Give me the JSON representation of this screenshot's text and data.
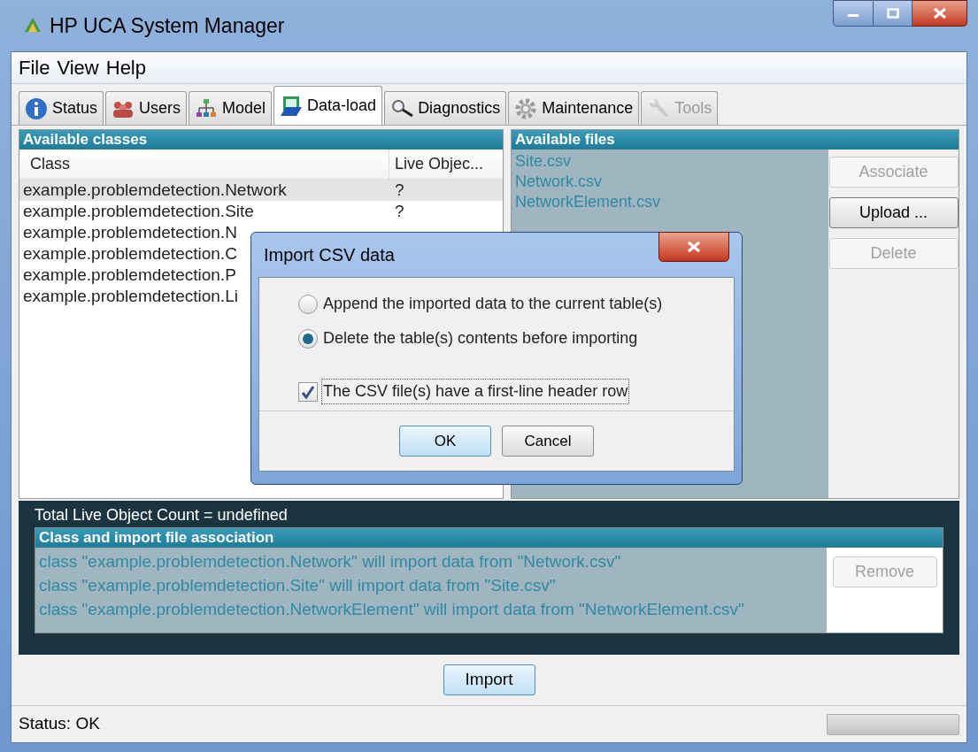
{
  "window": {
    "title": "HP UCA System Manager"
  },
  "menu": [
    "File",
    "View",
    "Help"
  ],
  "tabs": [
    {
      "label": "Status",
      "selected": false,
      "disabled": false
    },
    {
      "label": "Users",
      "selected": false,
      "disabled": false
    },
    {
      "label": "Model",
      "selected": false,
      "disabled": false
    },
    {
      "label": "Data-load",
      "selected": true,
      "disabled": false
    },
    {
      "label": "Diagnostics",
      "selected": false,
      "disabled": false
    },
    {
      "label": "Maintenance",
      "selected": false,
      "disabled": false
    },
    {
      "label": "Tools",
      "selected": false,
      "disabled": true
    }
  ],
  "classes_panel": {
    "title": "Available classes",
    "columns": [
      "Class",
      "Live Objec..."
    ],
    "rows": [
      {
        "class": "example.problemdetection.Network",
        "live": "?",
        "selected": true
      },
      {
        "class": "example.problemdetection.Site",
        "live": "?",
        "selected": false
      },
      {
        "class": "example.problemdetection.N",
        "selected": false
      },
      {
        "class": "example.problemdetection.C",
        "selected": false
      },
      {
        "class": "example.problemdetection.P",
        "selected": false
      },
      {
        "class": "example.problemdetection.Li",
        "selected": false
      }
    ]
  },
  "files_panel": {
    "title": "Available files",
    "files": [
      "Site.csv",
      "Network.csv",
      "NetworkElement.csv"
    ],
    "buttons": [
      {
        "label": "Associate",
        "disabled": true
      },
      {
        "label": "Upload ...",
        "disabled": false
      },
      {
        "label": "Delete",
        "disabled": true
      }
    ]
  },
  "total_count": "Total Live Object Count = undefined",
  "association_panel": {
    "title": "Class and import file association",
    "items": [
      "class \"example.problemdetection.Network\" will import data from \"Network.csv\"",
      "class \"example.problemdetection.Site\" will import data from \"Site.csv\"",
      "class \"example.problemdetection.NetworkElement\" will import data from \"NetworkElement.csv\""
    ],
    "button": {
      "label": "Remove",
      "disabled": true
    }
  },
  "import_button": "Import",
  "status_bar": {
    "text": "Status: OK"
  },
  "dialog": {
    "title": "Import CSV data",
    "options": [
      {
        "label": "Append the imported data to the current table(s)",
        "selected": false
      },
      {
        "label": "Delete the table(s) contents before importing",
        "selected": true
      }
    ],
    "checkbox": {
      "label": "The CSV file(s) have a first-line header row",
      "checked": true
    },
    "buttons": [
      "OK",
      "Cancel"
    ]
  }
}
